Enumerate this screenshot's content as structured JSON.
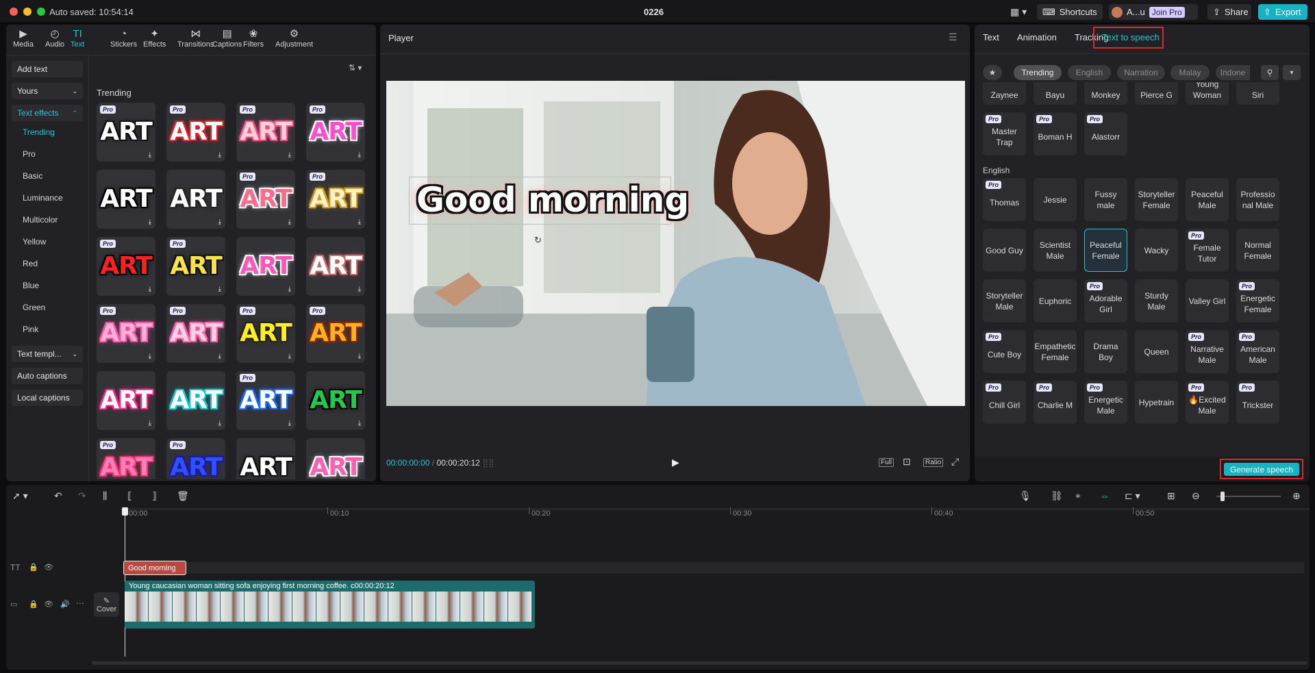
{
  "titlebar": {
    "autosave": "Auto saved: 10:54:14",
    "project_name": "0226",
    "shortcuts": "Shortcuts",
    "user_name": "A...u",
    "join_pro": "Join Pro",
    "share": "Share",
    "export": "Export"
  },
  "toolbar": {
    "items": [
      {
        "label": "Media",
        "icon": "media-icon"
      },
      {
        "label": "Audio",
        "icon": "audio-icon"
      },
      {
        "label": "Text",
        "icon": "text-icon",
        "active": true
      },
      {
        "label": "Stickers",
        "icon": "stickers-icon"
      },
      {
        "label": "Effects",
        "icon": "effects-icon"
      },
      {
        "label": "Transitions",
        "icon": "transitions-icon"
      },
      {
        "label": "Captions",
        "icon": "captions-icon"
      },
      {
        "label": "Filters",
        "icon": "filters-icon"
      },
      {
        "label": "Adjustment",
        "icon": "adjustment-icon"
      }
    ]
  },
  "sidebar": {
    "add_text": "Add text",
    "yours": "Yours",
    "text_effects": "Text effects",
    "effect_items": [
      "Trending",
      "Pro",
      "Basic",
      "Luminance",
      "Multicolor",
      "Yellow",
      "Red",
      "Blue",
      "Green",
      "Pink"
    ],
    "text_templates": "Text templ...",
    "auto_captions": "Auto captions",
    "local_captions": "Local captions"
  },
  "effects": {
    "section_title": "Trending",
    "tile_text": "ART"
  },
  "player": {
    "title": "Player",
    "overlay_text": "Good morning",
    "current_time": "00:00:00:00",
    "separator": "/",
    "total_time": "00:00:20:12",
    "full": "Full",
    "ratio": "Ratio"
  },
  "right_panel": {
    "tabs": [
      "Text",
      "Animation",
      "Tracking",
      "Text to speech"
    ],
    "active_tab": "Text to speech",
    "chips": [
      "Trending",
      "English",
      "Narration",
      "Malay",
      "Indone"
    ],
    "partial_row": [
      "Zaynee",
      "Bayu",
      "Monkey",
      "Pierce G",
      "Young Woman",
      "Siri"
    ],
    "row_special": [
      {
        "name": "Master Trap",
        "pro": true
      },
      {
        "name": "Boman H",
        "pro": true
      },
      {
        "name": "Alastorr",
        "pro": true
      }
    ],
    "english_heading": "English",
    "english_voices": [
      {
        "name": "Thomas",
        "pro": true
      },
      {
        "name": "Jessie",
        "pro": false
      },
      {
        "name": "Fussy male",
        "pro": false
      },
      {
        "name": "Storyteller Female",
        "pro": false
      },
      {
        "name": "Peaceful Male",
        "pro": false
      },
      {
        "name": "Professio nal Male",
        "pro": false
      },
      {
        "name": "Good Guy",
        "pro": false
      },
      {
        "name": "Scientist Male",
        "pro": false
      },
      {
        "name": "Peaceful Female",
        "pro": false,
        "selected": true
      },
      {
        "name": "Wacky",
        "pro": false
      },
      {
        "name": "Female Tutor",
        "pro": true
      },
      {
        "name": "Normal Female",
        "pro": false
      },
      {
        "name": "Storyteller Male",
        "pro": false
      },
      {
        "name": "Euphoric",
        "pro": false
      },
      {
        "name": "Adorable Girl",
        "pro": true
      },
      {
        "name": "Sturdy Male",
        "pro": false
      },
      {
        "name": "Valley Girl",
        "pro": false
      },
      {
        "name": "Energetic Female",
        "pro": true
      },
      {
        "name": "Cute Boy",
        "pro": true
      },
      {
        "name": "Empathetic Female",
        "pro": false
      },
      {
        "name": "Drama Boy",
        "pro": false
      },
      {
        "name": "Queen",
        "pro": false
      },
      {
        "name": "Narrative Male",
        "pro": true
      },
      {
        "name": "American Male",
        "pro": true
      },
      {
        "name": "Chill Girl",
        "pro": true
      },
      {
        "name": "Charlie M",
        "pro": true
      },
      {
        "name": "Energetic Male",
        "pro": true
      },
      {
        "name": "Hypetrain",
        "pro": false
      },
      {
        "name": "🔥Excited Male",
        "pro": true
      },
      {
        "name": "Trickster",
        "pro": true
      }
    ],
    "generate": "Generate speech",
    "pro_badge": "Pro"
  },
  "timeline": {
    "ticks": [
      "00:00",
      "00:10",
      "00:20",
      "00:30",
      "00:40",
      "00:50"
    ],
    "text_clip": "Good morning",
    "video_clip_title": "Young caucasian woman sitting sofa enjoying first morning coffee.",
    "video_clip_duration": "00:00:20:12",
    "cover": "Cover"
  },
  "colors": {
    "accent": "#22c7d3",
    "highlight_box": "#e0252b",
    "text_clip": "#b84a42",
    "video_clip": "#1d6b6d"
  }
}
